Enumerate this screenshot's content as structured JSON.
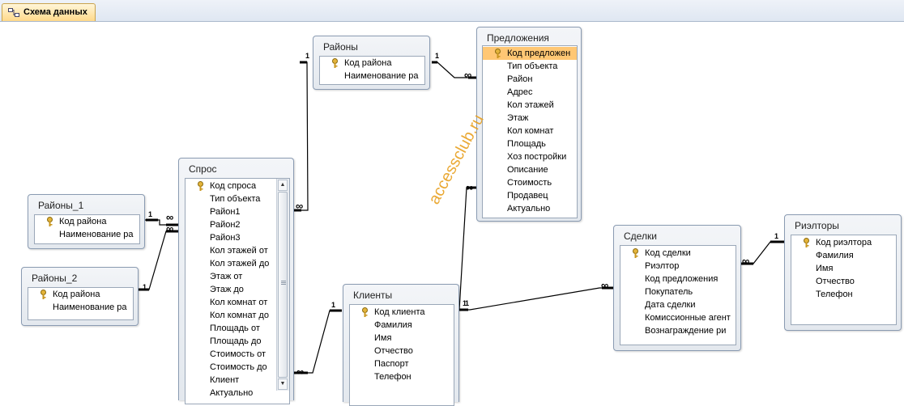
{
  "tab": {
    "title": "Схема данных",
    "icon": "relationship-diagram-icon"
  },
  "watermark": "accessclub.ru",
  "tables": {
    "rayony": {
      "title": "Районы",
      "fields": [
        "Код района",
        "Наименование ра"
      ],
      "pk": 0
    },
    "predlozheniya": {
      "title": "Предложения",
      "fields": [
        "Код предложен",
        "Тип объекта",
        "Район",
        "Адрес",
        "Кол этажей",
        "Этаж",
        "Кол комнат",
        "Площадь",
        "Хоз постройки",
        "Описание",
        "Стоимость",
        "Продавец",
        "Актуально"
      ],
      "pk": 0,
      "selected": 0
    },
    "rayony1": {
      "title": "Районы_1",
      "fields": [
        "Код района",
        "Наименование ра"
      ],
      "pk": 0
    },
    "rayony2": {
      "title": "Районы_2",
      "fields": [
        "Код района",
        "Наименование ра"
      ],
      "pk": 0
    },
    "spros": {
      "title": "Спрос",
      "fields": [
        "Код спроса",
        "Тип объекта",
        "Район1",
        "Район2",
        "Район3",
        "Кол этажей от",
        "Кол этажей до",
        "Этаж от",
        "Этаж до",
        "Кол комнат от",
        "Кол комнат до",
        "Площадь от",
        "Площадь до",
        "Стоимость от",
        "Стоимость до",
        "Клиент",
        "Актуально"
      ],
      "pk": 0
    },
    "klienty": {
      "title": "Клиенты",
      "fields": [
        "Код клиента",
        "Фамилия",
        "Имя",
        "Отчество",
        "Паспорт",
        "Телефон"
      ],
      "pk": 0
    },
    "sdelki": {
      "title": "Сделки",
      "fields": [
        "Код сделки",
        "Риэлтор",
        "Код предложения",
        "Покупатель",
        "Дата сделки",
        "Комиссионные агент",
        "Вознаграждение ри"
      ],
      "pk": 0
    },
    "rieltory": {
      "title": "Риэлторы",
      "fields": [
        "Код риэлтора",
        "Фамилия",
        "Имя",
        "Отчество",
        "Телефон"
      ],
      "pk": 0
    }
  },
  "relationships": {
    "one": "1",
    "many": "∞"
  }
}
